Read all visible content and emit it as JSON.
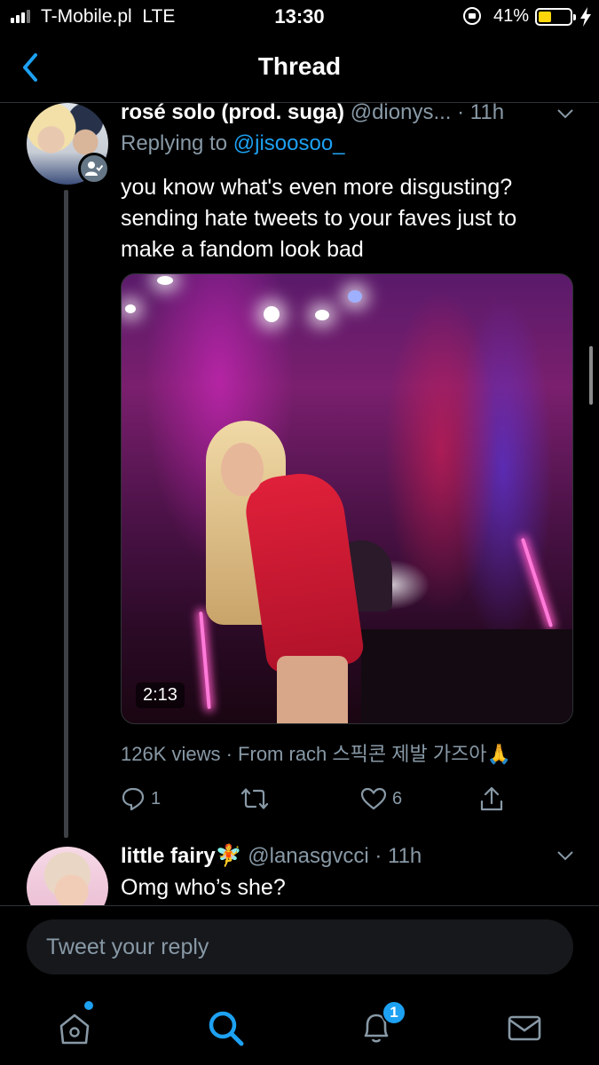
{
  "status_bar": {
    "carrier": "T-Mobile.pl",
    "network": "LTE",
    "time": "13:30",
    "battery_percent": "41%",
    "battery_level": 0.41,
    "battery_color": "#ffd60a"
  },
  "nav": {
    "back_icon": "chevron-left-icon",
    "title": "Thread"
  },
  "tweet": {
    "display_name": "rosé solo (prod. suga)",
    "handle": "@dionys...",
    "time": "· 11h",
    "replying_prefix": "Replying to ",
    "replying_to": "@jisoosoo_",
    "text_lines": [
      "you know what's even more disgusting?",
      "sending hate tweets to your faves just to",
      "make a fandom look bad"
    ],
    "media": {
      "duration": "2:13"
    },
    "views_line": "126K views · From rach 스픽콘 제발 가즈아🙏",
    "actions": {
      "reply_count": "1",
      "retweet_count": "",
      "like_count": "6",
      "icons": [
        "reply-icon",
        "retweet-icon",
        "like-icon",
        "share-icon"
      ]
    }
  },
  "reply_tweet": {
    "display_name": "little fairy🧚",
    "handle": "@lanasgvcci",
    "time": "· 11h",
    "text": "Omg who’s she?"
  },
  "composer": {
    "placeholder": "Tweet your reply"
  },
  "tab_bar": {
    "icons": [
      "home-icon",
      "search-icon",
      "notifications-icon",
      "messages-icon"
    ],
    "notification_count": "1",
    "accent_color": "#1da1f2"
  }
}
